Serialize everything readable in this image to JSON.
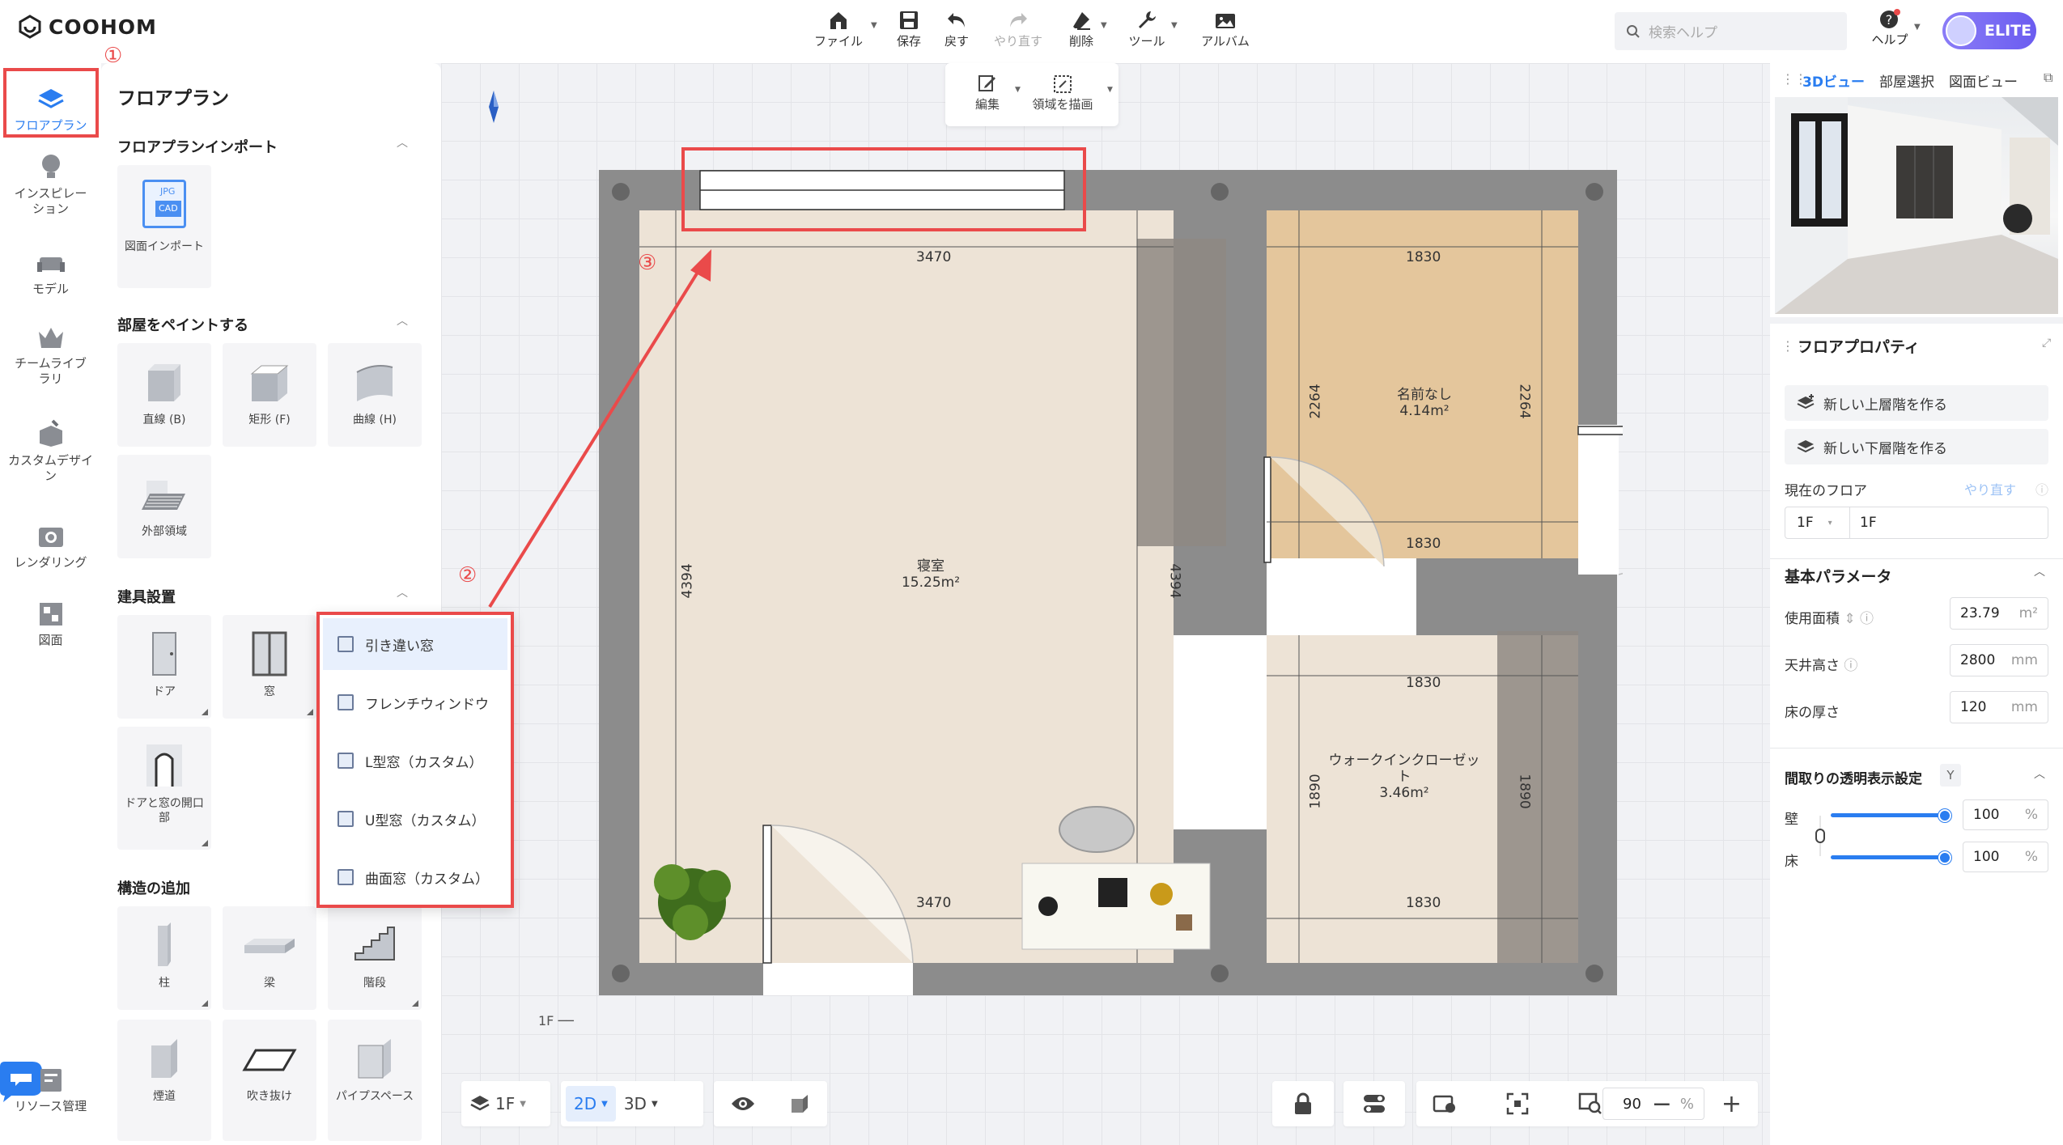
{
  "app": {
    "logo": "COOHOM"
  },
  "toolbar": {
    "items": [
      {
        "label": "ファイル",
        "icon": "home-icon"
      },
      {
        "label": "保存",
        "icon": "save-icon"
      },
      {
        "label": "戻す",
        "icon": "undo-icon"
      },
      {
        "label": "やり直す",
        "icon": "redo-icon"
      },
      {
        "label": "削除",
        "icon": "eraser-icon"
      },
      {
        "label": "ツール",
        "icon": "wrench-icon"
      },
      {
        "label": "アルバム",
        "icon": "album-icon"
      }
    ],
    "search_placeholder": "検索ヘルプ",
    "help_label": "ヘルプ",
    "plan_label": "ELITE"
  },
  "rail": {
    "items": [
      {
        "label": "フロアプラン"
      },
      {
        "label": "インスピレーション"
      },
      {
        "label": "モデル"
      },
      {
        "label": "チームライブラリ"
      },
      {
        "label": "カスタムデザイン"
      },
      {
        "label": "レンダリング"
      },
      {
        "label": "図面"
      },
      {
        "label": "リソース管理"
      }
    ]
  },
  "panel": {
    "title": "フロアプラン",
    "import_section": "フロアプランインポート",
    "import_tile": "図面インポート",
    "import_tags": [
      "JPG",
      "CAD"
    ],
    "paint_section": "部屋をペイントする",
    "paint_tiles": [
      "直線 (B)",
      "矩形 (F)",
      "曲線 (H)",
      "外部領域"
    ],
    "fixture_section": "建具設置",
    "fixture_tiles": [
      "ドア",
      "窓",
      "ドアと窓の開口部"
    ],
    "structure_section": "構造の追加",
    "structure_tiles": [
      "柱",
      "梁",
      "階段",
      "煙道",
      "吹き抜け",
      "パイプスペース"
    ]
  },
  "popup": {
    "items": [
      "引き違い窓",
      "フレンチウィンドウ",
      "L型窓（カスタム）",
      "U型窓（カスタム）",
      "曲面窓（カスタム）"
    ]
  },
  "edit_toolbar": {
    "edit": "編集",
    "draw": "領域を描画"
  },
  "plan": {
    "dims": {
      "top": "3470",
      "bottom": "3470",
      "left": "4394",
      "right": "4394",
      "rt_top": "1830",
      "rt_mid": "1830",
      "rt_left": "2264",
      "rt_right": "2264",
      "rb_top": "1830",
      "rb_bottom": "1830",
      "rb_left": "1890",
      "rb_right": "1890"
    },
    "rooms": [
      {
        "name": "寝室",
        "area": "15.25m²"
      },
      {
        "name": "名前なし",
        "area": "4.14m²"
      },
      {
        "name": "ウォークインクローゼット",
        "area": "3.46m²"
      }
    ],
    "floor_marker": "1F"
  },
  "annotations": [
    "①",
    "②",
    "③"
  ],
  "bottom": {
    "floor": "1F",
    "view2d": "2D",
    "view3d": "3D",
    "zoom": "90",
    "zoom_unit": "%"
  },
  "right": {
    "tabs": [
      "3Dビュー",
      "部屋選択",
      "図面ビュー"
    ],
    "prop_title": "フロアプロパティ",
    "btn_up": "新しい上層階を作る",
    "btn_down": "新しい下層階を作る",
    "current_floor_label": "現在のフロア",
    "current_floor_action": "やり直す",
    "floor_select": "1F",
    "floor_name": "1F",
    "basic_title": "基本パラメータ",
    "params": [
      {
        "label": "使用面積",
        "value": "23.79",
        "unit": "m²"
      },
      {
        "label": "天井高さ",
        "value": "2800",
        "unit": "mm"
      },
      {
        "label": "床の厚さ",
        "value": "120",
        "unit": "mm"
      }
    ],
    "transparency_title": "間取りの透明表示設定",
    "transparency_key": "Y",
    "wall_label": "壁",
    "wall_value": "100",
    "floor_label": "床",
    "floor_value": "100",
    "percent": "%"
  },
  "colors": {
    "accent": "#2a7df0",
    "annotation": "#ea4a4a",
    "wall": "#8c8c8c",
    "floor_light": "#ede3d6",
    "floor_wood": "#e6c9a1"
  }
}
